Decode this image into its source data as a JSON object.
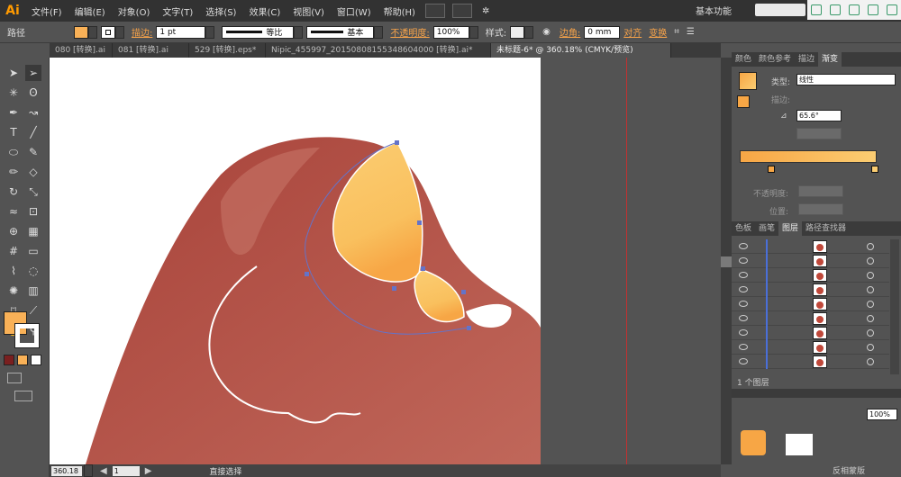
{
  "app": {
    "logo": "Ai"
  },
  "menu": [
    "文件(F)",
    "编辑(E)",
    "对象(O)",
    "文字(T)",
    "选择(S)",
    "效果(C)",
    "视图(V)",
    "窗口(W)",
    "帮助(H)"
  ],
  "workspace": {
    "label": "基本功能"
  },
  "control": {
    "selection_label": "路径",
    "stroke_label": "描边:",
    "stroke_value": "1 pt",
    "profile_label": "等比",
    "brush_label": "基本",
    "opacity_label": "不透明度:",
    "opacity_value": "100%",
    "style_label": "样式:",
    "corner_label": "边角:",
    "corner_value": "0 mm",
    "align_label": "对齐",
    "transform_label": "变换"
  },
  "tabs": [
    {
      "label": "080 [转换].ai"
    },
    {
      "label": "081 [转换].ai"
    },
    {
      "label": "529 [转换].eps*"
    },
    {
      "label": "Nipic_455997_20150808155348604000 [转换].ai*"
    },
    {
      "label": "未标题-6* @ 360.18% (CMYK/预览)"
    }
  ],
  "status": {
    "zoom": "360.18",
    "page": "1",
    "tool_name": "直接选择"
  },
  "panel_tabs_top": [
    "颜色",
    "颜色参考",
    "描边",
    "渐变"
  ],
  "gradient": {
    "type_label": "类型:",
    "type_value": "线性",
    "stroke_label": "描边:",
    "angle_value": "65.6°",
    "opacity_label": "不透明度:",
    "location_label": "位置:"
  },
  "panel_tabs_mid": [
    "色板",
    "画笔",
    "图层",
    "路径查找器"
  ],
  "layers": {
    "count_label": "1 个图层",
    "rows": 9
  },
  "watermark": {
    "opacity_value": "100%",
    "invert_label": "反相蒙版"
  },
  "colors": {
    "fill": "#f9b157",
    "accent": "#f7a34a",
    "artwork": "#c0574a"
  }
}
